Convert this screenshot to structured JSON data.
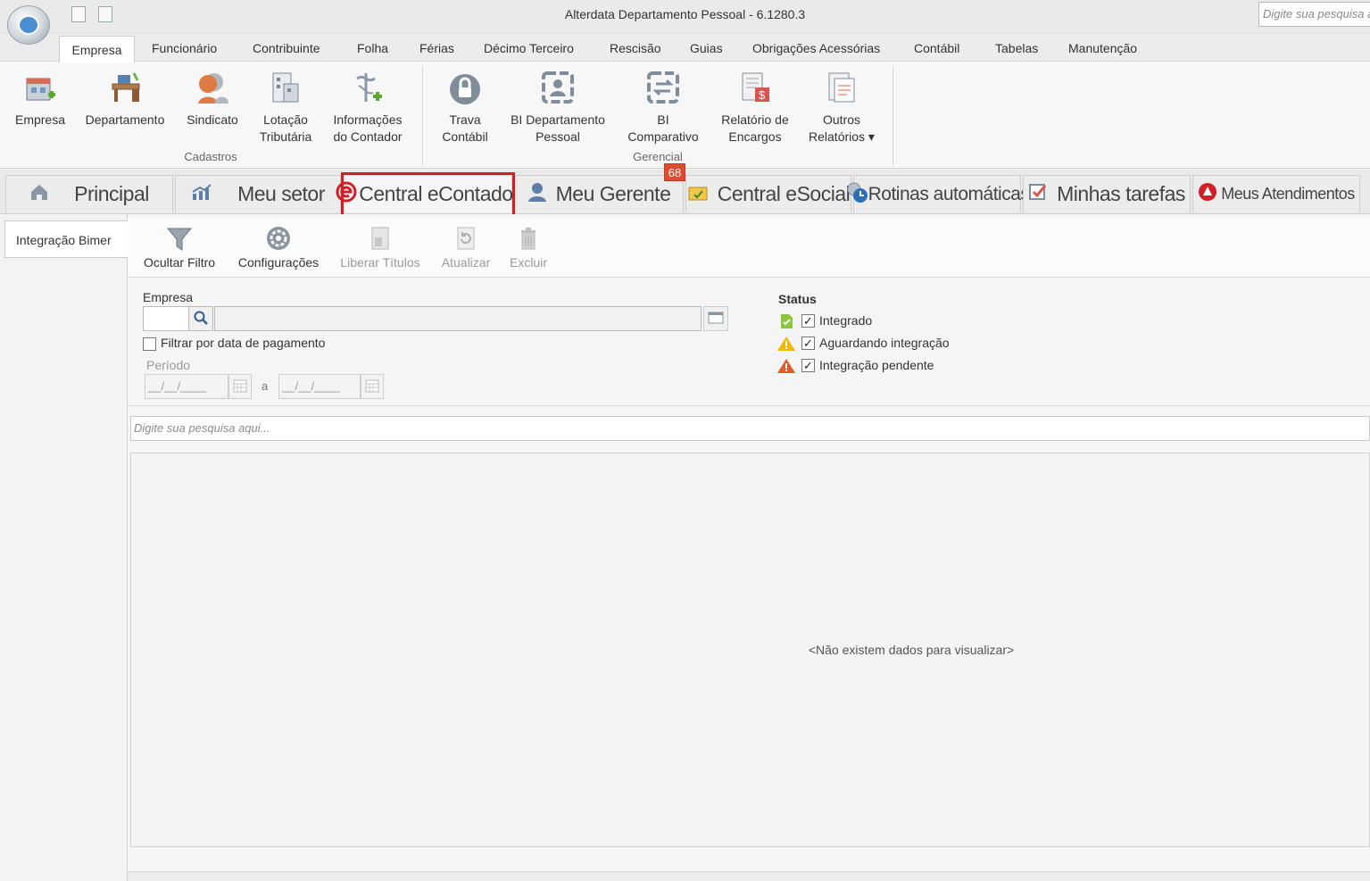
{
  "window": {
    "title": "Alterdata Departamento Pessoal - 6.1280.3",
    "search_placeholder": "Digite sua pesquisa aqui..."
  },
  "menu": [
    "Empresa",
    "Funcionário",
    "Contribuinte",
    "Folha",
    "Férias",
    "Décimo Terceiro",
    "Rescisão",
    "Guias",
    "Obrigações Acessórias",
    "Contábil",
    "Tabelas",
    "Manutenção"
  ],
  "ribbon": {
    "cadastros": {
      "label": "Cadastros",
      "buttons": [
        {
          "line1": "Empresa",
          "line2": "",
          "icon": "building-add-icon"
        },
        {
          "line1": "Departamento",
          "line2": "",
          "icon": "desk-icon"
        },
        {
          "line1": "Sindicato",
          "line2": "",
          "icon": "people-icon"
        },
        {
          "line1": "Lotação",
          "line2": "Tributária",
          "icon": "building-grid-icon"
        },
        {
          "line1": "Informações",
          "line2": "do Contador",
          "icon": "caduceus-add-icon"
        }
      ]
    },
    "gerencial": {
      "label": "Gerencial",
      "buttons": [
        {
          "line1": "Trava",
          "line2": "Contábil",
          "icon": "lock-icon"
        },
        {
          "line1": "BI Departamento",
          "line2": "Pessoal",
          "icon": "bi-person-icon"
        },
        {
          "line1": "BI",
          "line2": "Comparativo",
          "icon": "bi-compare-icon"
        },
        {
          "line1": "Relatório de",
          "line2": "Encargos",
          "icon": "report-money-icon"
        },
        {
          "line1": "Outros",
          "line2": "Relatórios ▾",
          "icon": "reports-icon"
        }
      ]
    }
  },
  "tabs": [
    {
      "label": "Principal",
      "icon": "home-icon"
    },
    {
      "label": "Meu setor",
      "icon": "chart-icon"
    },
    {
      "label": "Central eContador",
      "icon": "econtador-icon"
    },
    {
      "label": "Meu Gerente",
      "icon": "person-icon"
    },
    {
      "label": "Central eSocial",
      "icon": "folder-icon"
    },
    {
      "label": "Rotinas automáticas",
      "icon": "gear-clock-icon"
    },
    {
      "label": "Minhas tarefas",
      "icon": "checkbox-icon"
    },
    {
      "label": "Meus Atendimentos",
      "icon": "support-icon"
    }
  ],
  "badge": "68",
  "left_nav": {
    "item": "Integração Bimer"
  },
  "toolbar": [
    {
      "label": "Ocultar Filtro",
      "enabled": true,
      "icon": "funnel-icon"
    },
    {
      "label": "Configurações",
      "enabled": true,
      "icon": "gear-icon"
    },
    {
      "label": "Liberar Títulos",
      "enabled": false,
      "icon": "document-icon"
    },
    {
      "label": "Atualizar",
      "enabled": false,
      "icon": "refresh-icon"
    },
    {
      "label": "Excluir",
      "enabled": false,
      "icon": "trash-icon"
    }
  ],
  "filters": {
    "empresa_label": "Empresa",
    "empresa_code": "",
    "empresa_name": "",
    "filtrar_data_label": "Filtrar por data de pagamento",
    "filtrar_data_checked": false,
    "periodo_label": "Período",
    "date_from": "__/__/____",
    "date_to": "__/__/____",
    "date_sep": "a"
  },
  "status": {
    "title": "Status",
    "items": [
      {
        "label": "Integrado",
        "checked": true,
        "color": "#8cc63f"
      },
      {
        "label": "Aguardando integração",
        "checked": true,
        "color": "#f2b705"
      },
      {
        "label": "Integração pendente",
        "checked": true,
        "color": "#e05a2b"
      }
    ]
  },
  "grid": {
    "search_placeholder": "Digite sua pesquisa aqui...",
    "empty_message": "<Não existem dados para visualizar>"
  }
}
